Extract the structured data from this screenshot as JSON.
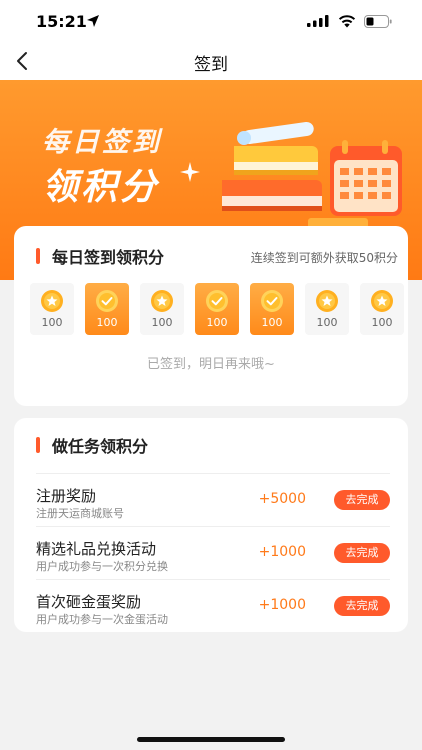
{
  "status_bar": {
    "time": "15:21"
  },
  "nav": {
    "title": "签到"
  },
  "banner": {
    "title": "每日签到",
    "subtitle": "领积分"
  },
  "signin": {
    "title": "每日签到领积分",
    "hint": "连续签到可额外获取50积分",
    "days": [
      {
        "points": "100",
        "checked": false
      },
      {
        "points": "100",
        "checked": true
      },
      {
        "points": "100",
        "checked": false
      },
      {
        "points": "100",
        "checked": true
      },
      {
        "points": "100",
        "checked": true
      },
      {
        "points": "100",
        "checked": false
      },
      {
        "points": "100",
        "checked": false
      }
    ],
    "status_message": "已签到，明日再来哦~"
  },
  "tasks": {
    "title": "做任务领积分",
    "items": [
      {
        "title": "注册奖励",
        "desc": "注册天运商城账号",
        "reward": "+5000",
        "button": "去完成"
      },
      {
        "title": "精选礼品兑换活动",
        "desc": "用户成功参与一次积分兑换",
        "reward": "+1000",
        "button": "去完成"
      },
      {
        "title": "首次砸金蛋奖励",
        "desc": "用户成功参与一次金蛋活动",
        "reward": "+1000",
        "button": "去完成"
      }
    ]
  },
  "colors": {
    "accent": "#ff5a2b",
    "banner": "#ff8a1a",
    "reward": "#ff7a1a"
  }
}
